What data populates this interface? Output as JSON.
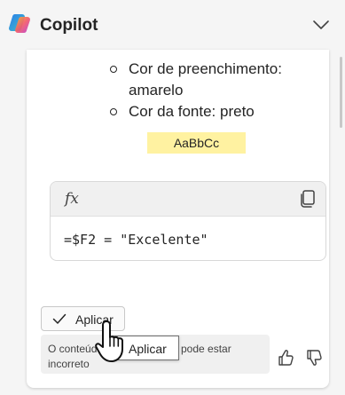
{
  "app": {
    "title": "Copilot",
    "icons": {
      "logo": "copilot-logo-icon",
      "collapse": "chevron-down-icon"
    }
  },
  "message": {
    "bullets": [
      {
        "line1": "Cor de preenchimento:",
        "line2": "amarelo"
      },
      {
        "line1": "Cor da fonte: preto",
        "line2": ""
      }
    ],
    "sample_text": "AaBbCc",
    "sample_fill_color": "#fff2a1",
    "formula_box": {
      "label": "fx",
      "formula": "=$F2 = \"Excelente\"",
      "copy_icon": "copy-icon"
    },
    "apply_button": {
      "label": "Aplicar",
      "icon": "checkmark-icon"
    },
    "tooltip": "Aplicar",
    "disclaimer": {
      "line1_start": "O conteúdo",
      "line1_end": "pode estar",
      "line2": "incorreto"
    },
    "feedback": {
      "like_icon": "thumbs-up-icon",
      "dislike_icon": "thumbs-down-icon"
    }
  }
}
